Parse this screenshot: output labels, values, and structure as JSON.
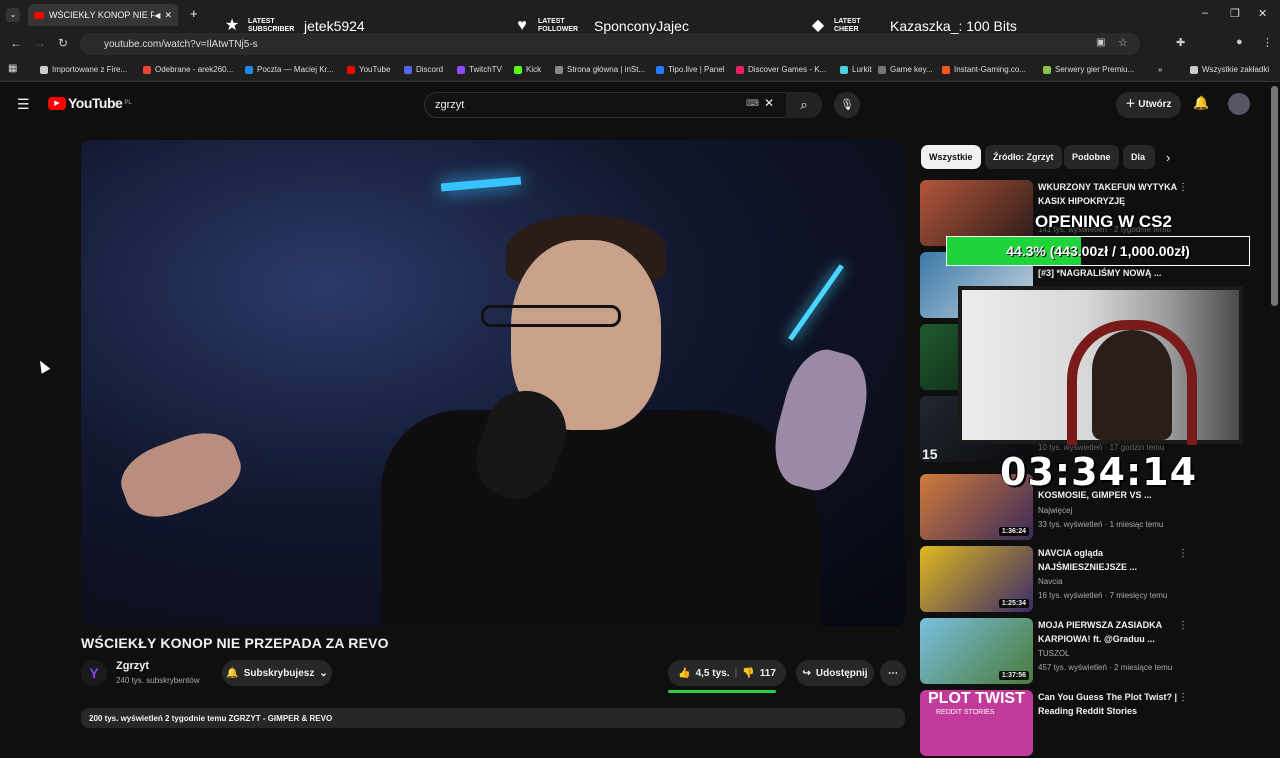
{
  "browser": {
    "tab_title": "WŚCIEKŁY KONOP NIE PRZEP",
    "url": "youtube.com/watch?v=IlAtwTNj5-s",
    "bookmarks": [
      {
        "label": "Importowane z Fire...",
        "color": "#ccc"
      },
      {
        "label": "Odebrane - arek260...",
        "color": "#ea4335"
      },
      {
        "label": "Poczta — Maciej Kr...",
        "color": "#1e88e5"
      },
      {
        "label": "YouTube",
        "color": "#ff0000"
      },
      {
        "label": "Discord",
        "color": "#5865f2"
      },
      {
        "label": "TwitchTV",
        "color": "#9146ff"
      },
      {
        "label": "Kick",
        "color": "#53fc18"
      },
      {
        "label": "Strona główna | inSt...",
        "color": "#888"
      },
      {
        "label": "Tipo.live | Panel",
        "color": "#2979ff"
      },
      {
        "label": "Discover Games - K...",
        "color": "#e91e63"
      },
      {
        "label": "Lurkit",
        "color": "#4dd0e1"
      },
      {
        "label": "Game key...",
        "color": "#777"
      },
      {
        "label": "Instant-Gaming.co...",
        "color": "#ff5722"
      },
      {
        "label": "Serwery gier Premiu...",
        "color": "#8bc34a"
      }
    ],
    "all_bookmarks": "Wszystkie zakładki"
  },
  "alerts": [
    {
      "label": "LATEST SUBSCRIBER",
      "value": "jetek5924",
      "icon": "star-icon"
    },
    {
      "label": "LATEST FOLLOWER",
      "value": "SponconyJajec",
      "icon": "heart-icon"
    },
    {
      "label": "LATEST CHEER",
      "value": "Kazaszka_: 100 Bits",
      "icon": "diamond-icon"
    }
  ],
  "youtube": {
    "logo": "YouTube",
    "region": "PL",
    "search_value": "zgrzyt",
    "create_label": "Utwórz"
  },
  "video": {
    "title": "WŚCIEKŁY KONOP NIE PRZEPADA ZA REVO",
    "channel": "Zgrzyt",
    "subscribers": "240 tys. subskrybentów",
    "subscribed_label": "Subskrybujesz",
    "likes": "4,5 tys.",
    "dislikes": "117",
    "share_label": "Udostępnij",
    "desc_line": "200 tys. wyświetleń  2 tygodnie temu  ZGRZYT - GIMPER & REVO"
  },
  "chips": [
    "Wszystkie",
    "Źródło: Zgrzyt",
    "Podobne",
    "Dla C"
  ],
  "recommendations": [
    {
      "title": "WKURZONY TAKEFUN WYTYKA KASIX HIPOKRYZJĘ",
      "channel": "",
      "meta": "141 tys. wyświetleń · 2 tygodnie temu",
      "duration": "",
      "thumb": "#7a3b3b"
    },
    {
      "title": "[#3] *NAGRALIŚMY NOWĄ ...",
      "channel": "",
      "meta": "",
      "duration": "",
      "thumb": "#3b5a7a"
    },
    {
      "title": "",
      "channel": "",
      "meta": "",
      "duration": "",
      "thumb": "#1e4a2a"
    },
    {
      "title": "",
      "channel": "",
      "meta": "10 tys. wyświetleń · 17 godzin temu",
      "duration": "",
      "thumb": "#22262e"
    },
    {
      "title": "KOSMOSIE, GIMPER VS ...",
      "channel": "Najwięcej",
      "meta": "33 tys. wyświetleń · 1 miesiąc temu",
      "duration": "1:36:24",
      "thumb": "#8a4a2a"
    },
    {
      "title": "NAVCIA ogląda NAJŚMIESZNIEJSZE ...",
      "channel": "Navcia",
      "meta": "16 tys. wyświetleń · 7 miesięcy temu",
      "duration": "1:25:34",
      "thumb": "#b08a1c"
    },
    {
      "title": "MOJA PIERWSZA ZASIADKA KARPIOWA! ft. @Graduu ...",
      "channel": "TUSZOL",
      "meta": "457 tys. wyświetleń · 2 miesiące temu",
      "duration": "1:37:56",
      "thumb": "#4a8a5a"
    },
    {
      "title": "Can You Guess The Plot Twist? | Reading Reddit Stories",
      "channel": "",
      "meta": "",
      "duration": "",
      "thumb": "#c23a9a"
    }
  ],
  "overlay": {
    "goal_title": "OPENING W CS2",
    "goal_percent": 0.443,
    "goal_text": "44.3% (443.00zł / 1,000.00zł)",
    "timer": "03:34:14",
    "plot_twist_label": "PLOT TWIST",
    "plot_twist_sub": "REDDIT STORIES"
  }
}
